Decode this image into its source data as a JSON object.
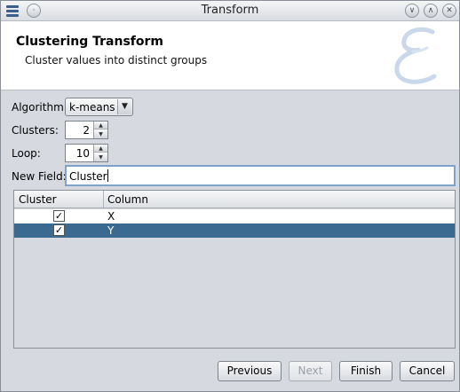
{
  "window": {
    "title": "Transform",
    "controls": {
      "minimize": "∨",
      "maximize": "∧",
      "close": "✕",
      "menu": "·"
    }
  },
  "banner": {
    "title": "Clustering Transform",
    "subtitle": "Cluster values into distinct groups"
  },
  "form": {
    "algorithm_label": "Algorithm:",
    "algorithm_value": "k-means",
    "clusters_label": "Clusters:",
    "clusters_value": "2",
    "loop_label": "Loop:",
    "loop_value": "10",
    "new_field_label": "New Field:",
    "new_field_value": "Cluster"
  },
  "table": {
    "headers": [
      "Cluster",
      "Column"
    ],
    "rows": [
      {
        "checked": true,
        "checkmark": "✓",
        "column": "X",
        "selected": false
      },
      {
        "checked": true,
        "checkmark": "✓",
        "column": "Y",
        "selected": true
      }
    ]
  },
  "buttons": {
    "previous": "Previous",
    "next": "Next",
    "finish": "Finish",
    "cancel": "Cancel"
  },
  "colors": {
    "selection": "#3b6a90",
    "window_bg": "#d6d9df",
    "focus_border": "#7ea3c9"
  },
  "icons": {
    "app_menu": "hamburger-menu-icon",
    "banner_logo": "script-e-logo",
    "combo_arrow": "triangle-down-icon",
    "spin_up": "arrow-up-icon",
    "spin_down": "arrow-down-icon"
  }
}
